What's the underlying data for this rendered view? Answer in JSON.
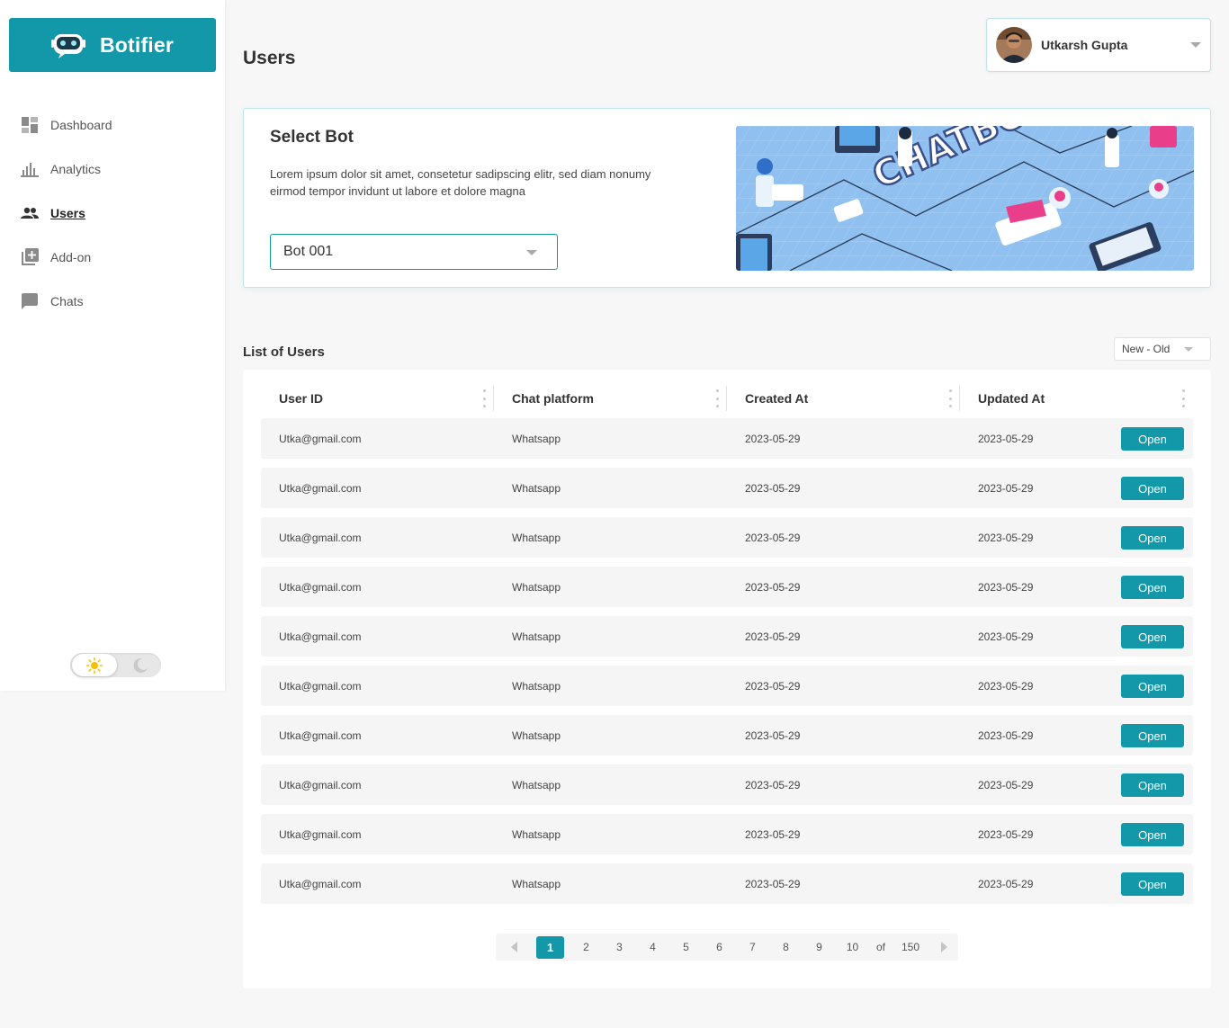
{
  "brand": {
    "name": "Botifier"
  },
  "nav": [
    {
      "label": "Dashboard",
      "icon": "dashboard-icon"
    },
    {
      "label": "Analytics",
      "icon": "bar-chart-icon"
    },
    {
      "label": "Users",
      "icon": "users-icon",
      "active": true
    },
    {
      "label": "Add-on",
      "icon": "add-library-icon"
    },
    {
      "label": "Chats",
      "icon": "chat-bubble-icon"
    }
  ],
  "theme": {
    "mode": "light"
  },
  "header": {
    "title": "Users"
  },
  "user": {
    "name": "Utkarsh Gupta"
  },
  "select_bot": {
    "title": "Select Bot",
    "description": "Lorem ipsum dolor sit amet, consetetur sadipscing elitr, sed diam nonumy eirmod tempor invidunt ut labore et dolore magna",
    "selected": "Bot 001"
  },
  "list": {
    "title": "List of Users",
    "sort": "New - Old",
    "columns": [
      "User ID",
      "Chat platform",
      "Created At",
      "Updated At"
    ],
    "rows": [
      [
        "Utka@gmail.com",
        "Whatsapp",
        "2023-05-29",
        "2023-05-29"
      ],
      [
        "Utka@gmail.com",
        "Whatsapp",
        "2023-05-29",
        "2023-05-29"
      ],
      [
        "Utka@gmail.com",
        "Whatsapp",
        "2023-05-29",
        "2023-05-29"
      ],
      [
        "Utka@gmail.com",
        "Whatsapp",
        "2023-05-29",
        "2023-05-29"
      ],
      [
        "Utka@gmail.com",
        "Whatsapp",
        "2023-05-29",
        "2023-05-29"
      ],
      [
        "Utka@gmail.com",
        "Whatsapp",
        "2023-05-29",
        "2023-05-29"
      ],
      [
        "Utka@gmail.com",
        "Whatsapp",
        "2023-05-29",
        "2023-05-29"
      ],
      [
        "Utka@gmail.com",
        "Whatsapp",
        "2023-05-29",
        "2023-05-29"
      ],
      [
        "Utka@gmail.com",
        "Whatsapp",
        "2023-05-29",
        "2023-05-29"
      ],
      [
        "Utka@gmail.com",
        "Whatsapp",
        "2023-05-29",
        "2023-05-29"
      ]
    ],
    "action_label": "Open"
  },
  "pagination": {
    "pages": [
      "1",
      "2",
      "3",
      "4",
      "5",
      "6",
      "7",
      "8",
      "9",
      "10"
    ],
    "current": "1",
    "of_label": "of",
    "total": "150"
  },
  "colors": {
    "accent": "#1298a8",
    "row_bg": "#f5f5f5",
    "page_bg": "#f7f7f7"
  }
}
